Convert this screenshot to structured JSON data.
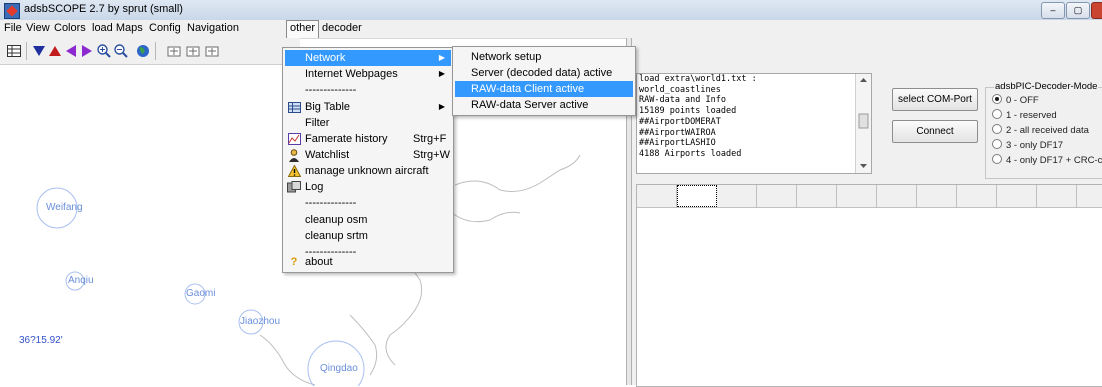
{
  "window": {
    "title": "adsbSCOPE 2.7 by sprut  (small)",
    "controls": [
      "–",
      "▢"
    ]
  },
  "menubar": {
    "items": [
      "File",
      "View",
      "Colors",
      "load Maps",
      "Config",
      "Navigation",
      "other",
      "decoder"
    ]
  },
  "toolbar": {
    "icons": [
      "table-icon",
      "arrow-down-icon",
      "arrow-up-icon",
      "arrow-left-icon",
      "arrow-right-icon",
      "zoom-in-icon",
      "zoom-out-icon",
      "globe-icon",
      "airplane-icon",
      "airplane-icon",
      "airplane-icon"
    ]
  },
  "map": {
    "cities": [
      "Weifang",
      "Anqiu",
      "Gaomi",
      "Jiaozhou",
      "Qingdao"
    ],
    "coordinate": "36?15.92'"
  },
  "log": {
    "lines": [
      "load extra\\world1.txt :",
      "world_coastlines",
      "RAW-data and Info",
      "15189 points loaded",
      "##AirportDOMERAT",
      "##AirportWAIROA",
      "##AirportLASHIO",
      "4188 Airports loaded"
    ]
  },
  "buttons": {
    "select_com_port": "select COM-Port",
    "connect": "Connect"
  },
  "decoder_mode": {
    "title": "adsbPIC-Decoder-Mode",
    "options": [
      "0 - OFF",
      "1 - reserved",
      "2 - all received data",
      "3 - only DF17",
      "4 - only DF17 + CRC-c"
    ],
    "selected": 0
  },
  "other_menu": {
    "items": [
      {
        "label": "Network",
        "arrow": "▶",
        "highlighted": true
      },
      {
        "label": "Internet Webpages",
        "arrow": "▶"
      },
      {
        "label": "--------------"
      },
      {
        "label": "Big Table",
        "arrow": "▶",
        "icon": "table-icon"
      },
      {
        "label": "Filter"
      },
      {
        "label": "Famerate history",
        "shortcut": "Strg+F",
        "icon": "chart-icon"
      },
      {
        "label": "Watchlist",
        "shortcut": "Strg+W",
        "icon": "person-icon"
      },
      {
        "label": "manage unknown aircraft",
        "icon": "warning-icon"
      },
      {
        "label": "Log",
        "icon": "log-icon"
      },
      {
        "label": "--------------"
      },
      {
        "label": "cleanup osm"
      },
      {
        "label": "cleanup srtm"
      },
      {
        "label": "--------------"
      },
      {
        "label": "about",
        "icon": "question-icon"
      }
    ]
  },
  "network_submenu": {
    "items": [
      {
        "label": "Network setup"
      },
      {
        "label": "Server (decoded data) active"
      },
      {
        "label": "RAW-data Client active",
        "highlighted": true
      },
      {
        "label": "RAW-data Server active"
      }
    ]
  },
  "colors": {
    "highlight": "#3399ff",
    "map_label": "#6a8fd8",
    "coordinate": "#3151c9"
  }
}
